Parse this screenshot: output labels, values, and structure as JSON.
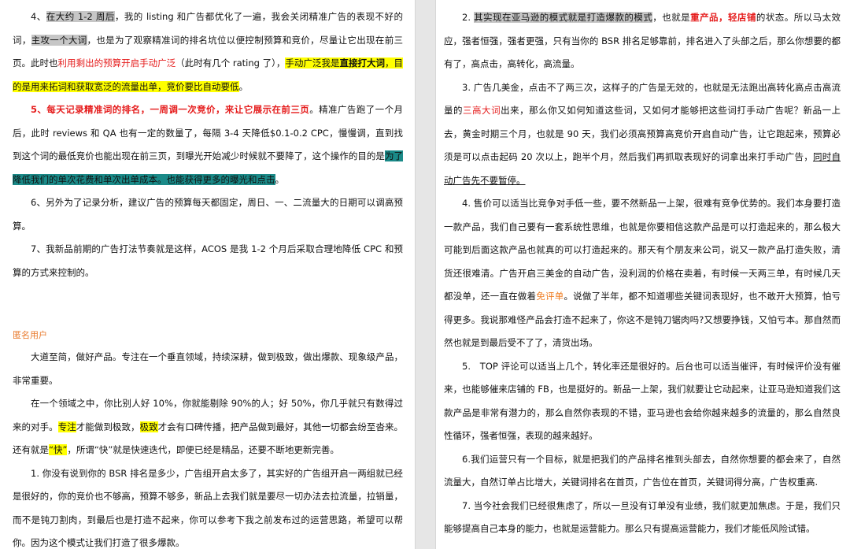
{
  "left": {
    "p4": {
      "s1": "4、",
      "s2": "在大约 1-2 周后",
      "s3": "，我的 listing 和广告都优化了一遍，我会关闭精准广告的表现不好的词，",
      "s4": "主攻一个大词",
      "s5": "，也是为了观察精准词的排名坑位以便控制预算和竞价，尽量让它出现在前三页。此时也",
      "s6": "利用剩出的预算开启手动广泛",
      "s7": "（此时有几个 rating 了），",
      "s8": "手动广泛我是",
      "s9": "直接打大词",
      "s10": "，目的是用来拓词和获取宽泛的流量出单，竞价要比自动要低",
      "s11": "。"
    },
    "p5": {
      "s1": "5、每天记录精准词的排名，一周调一次竞价，来让它展示在前三页",
      "s2": "。精准广告跑了一个月后，此时 reviews 和 QA 也有一定的数量了，每隔 3-4 天降低$0.1-0.2 CPC，慢慢调，直到找到这个词的最低竞价也能出现在前三页，到曝光开始减少时候就不要降了，这个操作的目的是",
      "s3": "为了降低我们的单次花费和单次出单成本。也能获得更多的曝光和点击",
      "s4": "。"
    },
    "p6": "6、另外为了记录分析，建议广告的预算每天都固定，周日、一、二流量大的日期可以调高预算。",
    "p7": "7、我新品前期的广告打法节奏就是这样，ACOS 是我 1-2 个月后采取合理地降低 CPC 和预算的方式来控制的。",
    "author": "匿名用户",
    "a1": "大道至简，做好产品。专注在一个垂直领域，持续深耕，做到极致，做出爆款、现象级产品，非常重要。",
    "a2": {
      "s1": "在一个领域之中，你比别人好 10%，你就能剔除 90%的人；好 50%，你几乎就只有数得过来的对手。",
      "s2": "专注",
      "s3": "才能做到极致，",
      "s4": "极致",
      "s5": "才会有口碑传播，把产品做到最好，其他一切都会纷至沓来。还有就是",
      "s6": "“快”",
      "s7": "，所谓“快”就是快速迭代，即便已经是精品，还要不断地更新完善。"
    },
    "a3": "1. 你没有说到你的 BSR 排名是多少，广告组开启太多了，其实好的广告组开启一两组就已经是很好的，你的竞价也不够高，预算不够多，新品上去我们就是要尽一切办法去拉流量，拉销量，而不是钝刀割肉，到最后也是打造不起来，你可以参考下我之前发布过的运营思路，希望可以帮你。因为这个模式让我们打造了很多爆款。"
  },
  "right": {
    "r2": {
      "s1": "2. ",
      "s2": "其实现在亚马逊的模式就是打造爆款的模式",
      "s3": "，也就是",
      "s4": "重产品，轻店铺",
      "s5": "的状态。所以马太效应，强者恒强，强者更强，只有当你的 BSR 排名足够靠前，排名进入了头部之后，那么你想要的都有了，高点击，高转化，高流量。"
    },
    "r3": {
      "s1": "3. 广告几美金，点击不了两三次，这样子的广告是无效的，也就是无法跑出高转化高点击高流量的",
      "s2": "三高大词",
      "s3": "出来，那么你又如何知道这些词，又如何才能够把这些词打手动广告呢？新品一上去，黄金时期三个月，也就是 90 天，我们必须高预算高竞价开启自动广告，让它跑起来，预算必须是可以点击起码 20 次以上，跑半个月，然后我们再抓取表现好的词拿出来打手动广告，",
      "s4": "同时自动广告先不要暂停。"
    },
    "r4": {
      "s1": "4. 售价可以适当比竞争对手低一些，要不然新品一上架，很难有竞争优势的。我们本身要打造一款产品，我们自己要有一套系统性思维，也就是你要相信这款产品是可以打造起来的，那么极大可能到后面这款产品也就真的可以打造起来的。那天有个朋友来公司，说又一款产品打造失败，清货还很难清。广告开启三美金的自动广告，没利润的价格在卖着，有时候一天两三单，有时候几天都没单，还一直在做着",
      "s2": "免评单",
      "s3": "。说做了半年，都不知道哪些关键词表现好，也不敢开大预算，怕亏得更多。我说那难怪产品会打造不起来了，你这不是钝刀锯肉吗?又想要挣钱，又怕亏本。那自然而然也就是到最后受不了了，清货出场。"
    },
    "r5": "5.　TOP 评论可以适当上几个，转化率还是很好的。后台也可以适当催评，有时候评价没有催来，也能够催来店铺的 FB，也是挺好的。新品一上架，我们就要让它动起来，让亚马逊知道我们这款产品是非常有潜力的，那么自然你表现的不错，亚马逊也会给你越来越多的流量的，那么自然良性循环，强者恒强，表现的越来越好。",
    "r6": "6.我们运营只有一个目标，就是把我们的产品排名推到头部去，自然你想要的都会来了，自然流量大，自然订单占比增大，关键词排名在首页，广告位在首页，关键词得分高，广告权重高.",
    "r7": "7. 当今社会我们已经很焦虑了，所以一旦没有订单没有业绩，我们就更加焦虑。于是，我们只能够提高自己本身的能力，也就是运营能力。那么只有提高运营能力，我们才能低风险试错。"
  }
}
